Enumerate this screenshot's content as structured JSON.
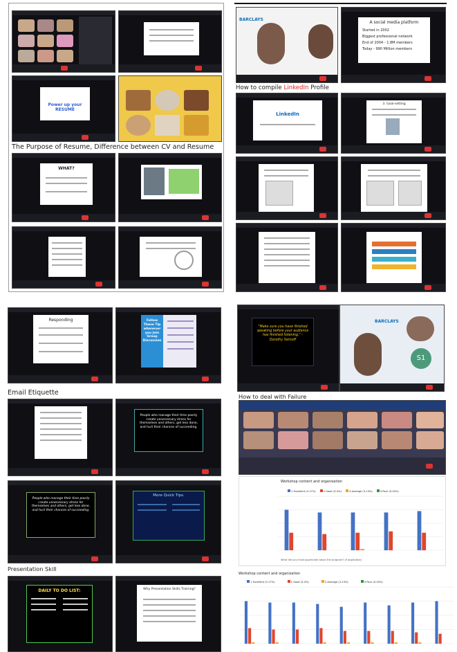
{
  "sections": {
    "purpose": "The Purpose of Resume, Difference between CV and Resume",
    "linkedin_prefix": "How to compile ",
    "linkedin_word": "LinkedIn",
    "linkedin_suffix": " Profile",
    "email": "Email Etiquette",
    "presentation": "Presentation Skill",
    "failure": "How to deal with Failure"
  },
  "slides": {
    "power_resume": "Power up your RESUME",
    "what": "WHAT?",
    "social_platform": "A social media platform",
    "social_points": [
      "Started in 2002",
      "Biggest professional network",
      "End of 2004 - 1.8M members",
      "Today - 990 Million members"
    ],
    "linkedin_logo": "LinkedIn",
    "goal_setting": "3. Goal-setting",
    "responding": "Responding",
    "follow_tips": "Follow These Tip whenever you Join Group Discussion",
    "people_manage": "People who manage their time poorly create unnecessary stress for themselves and others, get less done, and hurt their chances of succeeding.",
    "more_quick": "More Quick Tips.",
    "daily_todo": "DAILY TO DO LIST:",
    "why_present": "Why Presentation Skills Training?",
    "quote": "\"Make sure you have finished speaking before your audience has finished listening.\" - Dorothy Sarnoff",
    "avatar": "S1",
    "barclays": "BARCLAYS"
  },
  "charts": {
    "top_title": "Workshop content and organization",
    "top_footer": "What did you most appreciate about the program? (if applicable)",
    "bottom_title": "Workshop content and organization",
    "legend": [
      "1 Excellent (3-17%)",
      "2 Good (3-4%)",
      "3 Average (3-13%)",
      "4 Poor (0-20%)"
    ]
  },
  "chart_data": [
    {
      "type": "bar",
      "title": "Workshop content and organization",
      "categories": [
        "1",
        "2",
        "3",
        "4",
        "5"
      ],
      "ylim": [
        0,
        40
      ],
      "series": [
        {
          "name": "1 Excellent (3-17%)",
          "values": [
            30,
            28,
            28,
            28,
            29
          ]
        },
        {
          "name": "2 Good (3-4%)",
          "values": [
            13,
            12,
            13,
            14,
            13
          ]
        },
        {
          "name": "3 Average (3-13%)",
          "values": [
            0,
            0,
            1,
            0,
            0
          ]
        },
        {
          "name": "4 Poor (0-20%)",
          "values": [
            0,
            0,
            0,
            0,
            0
          ]
        }
      ]
    },
    {
      "type": "bar",
      "title": "Workshop content and organization",
      "categories": [
        "1",
        "2",
        "3",
        "4",
        "5",
        "6",
        "7",
        "8",
        "9"
      ],
      "ylim": [
        0,
        40
      ],
      "series": [
        {
          "name": "1 Excellent (3-17%)",
          "values": [
            30,
            29,
            29,
            28,
            26,
            29,
            27,
            29,
            30
          ]
        },
        {
          "name": "2 Good (3-4%)",
          "values": [
            11,
            10,
            10,
            11,
            9,
            9,
            9,
            8,
            7
          ]
        },
        {
          "name": "3 Average (3-13%)",
          "values": [
            1,
            1,
            0,
            1,
            1,
            1,
            1,
            1,
            0
          ]
        },
        {
          "name": "4 Poor (0-20%)",
          "values": [
            0,
            0,
            0,
            0,
            0,
            0,
            0,
            0,
            0
          ]
        }
      ]
    }
  ],
  "colors": [
    "#4472c4",
    "#e0452d",
    "#f0a12a",
    "#2e9a3b"
  ]
}
